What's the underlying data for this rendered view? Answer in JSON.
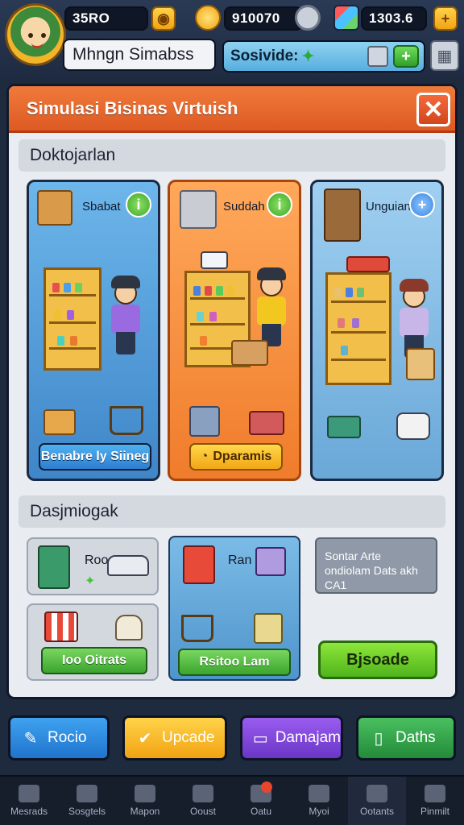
{
  "hud": {
    "resource1": "35RO",
    "resource2": "910070",
    "resource3": "1303.6",
    "business_name": "Mhngn Simabss",
    "status_text": "Sosivide:",
    "plus_label": "+",
    "top_plus_label": "+"
  },
  "modal": {
    "title": "Simulasi Bisinas Virtuish",
    "close_label": "✕",
    "section1_title": "Doktojarlan",
    "section2_title": "Dasjmiogak",
    "cards": [
      {
        "label": "Sbabat",
        "button": "Benabre ly Siineg"
      },
      {
        "label": "Suddah",
        "button": "Dparamis"
      },
      {
        "label": "Unguian",
        "button": ""
      }
    ],
    "small_cards": {
      "a_label": "Roo",
      "b_label": "Ran",
      "c_button": "Ioo Oitrats",
      "d_button": "Rsitoo Lam"
    },
    "info_text": "Sontar Arte ondiolam Dats akh CA1",
    "green_button": "Bjsoade"
  },
  "actions": [
    {
      "label": "Rocio",
      "icon": "✎"
    },
    {
      "label": "Upcade",
      "icon": "✔"
    },
    {
      "label": "Damajam",
      "icon": "▭"
    },
    {
      "label": "Daths",
      "icon": "▯"
    }
  ],
  "nav": [
    {
      "label": "Mesrads"
    },
    {
      "label": "Sosgtels"
    },
    {
      "label": "Mapon"
    },
    {
      "label": "Ooust"
    },
    {
      "label": "Oatu"
    },
    {
      "label": "Myoi"
    },
    {
      "label": "Ootants"
    },
    {
      "label": "Pinmilt"
    }
  ],
  "colors": {
    "modal_header": "#dd5a23",
    "card_blue": "#3f86c9",
    "card_orange": "#f07c2c",
    "accent_green": "#3aa52e"
  }
}
